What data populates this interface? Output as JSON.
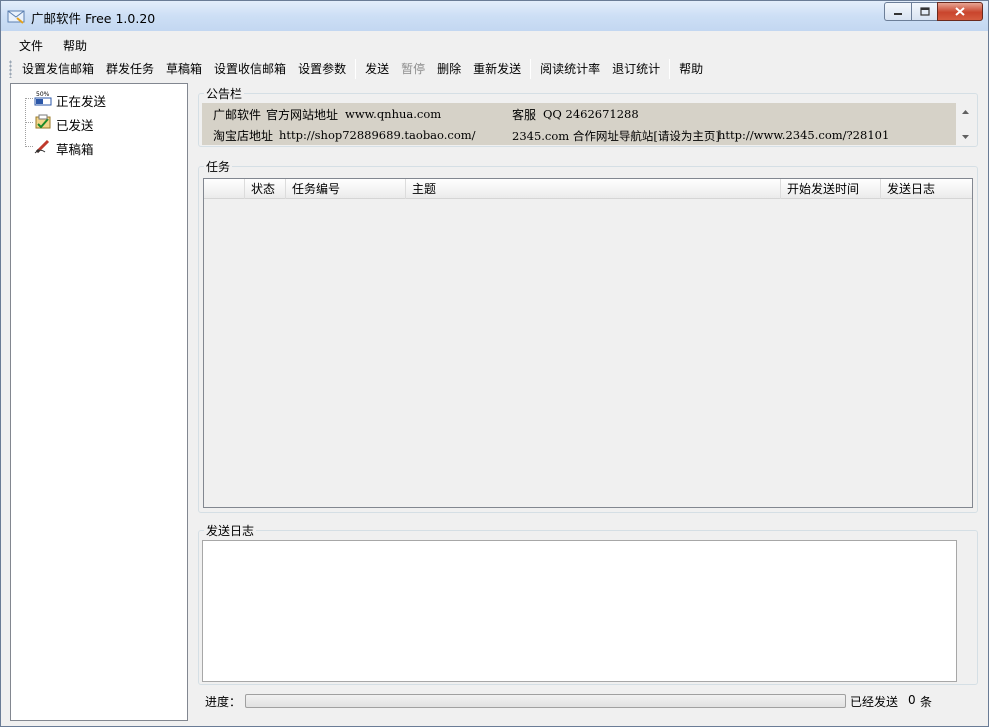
{
  "window": {
    "title": "广邮软件 Free 1.0.20"
  },
  "menu": {
    "items": [
      {
        "label": "文件"
      },
      {
        "label": "帮助"
      }
    ]
  },
  "toolbar": {
    "groups": [
      [
        {
          "label": "设置发信邮箱",
          "enabled": true
        },
        {
          "label": "群发任务",
          "enabled": true
        },
        {
          "label": "草稿箱",
          "enabled": true
        },
        {
          "label": "设置收信邮箱",
          "enabled": true
        },
        {
          "label": "设置参数",
          "enabled": true
        }
      ],
      [
        {
          "label": "发送",
          "enabled": true
        },
        {
          "label": "暂停",
          "enabled": false
        },
        {
          "label": "删除",
          "enabled": true
        },
        {
          "label": "重新发送",
          "enabled": true
        }
      ],
      [
        {
          "label": "阅读统计率",
          "enabled": true
        },
        {
          "label": "退订统计",
          "enabled": true
        }
      ],
      [
        {
          "label": "帮助",
          "enabled": true
        }
      ]
    ]
  },
  "tree": {
    "items": [
      {
        "label": "正在发送",
        "icon": "sending-progress-icon"
      },
      {
        "label": "已发送",
        "icon": "sent-mail-icon"
      },
      {
        "label": "草稿箱",
        "icon": "draft-pen-icon"
      }
    ]
  },
  "notice": {
    "title": "公告栏",
    "row1": {
      "name": "广邮软件",
      "site_label": "官方网站地址",
      "site_url": "www.qnhua.com",
      "service_label": "客服",
      "qq": "QQ 2462671288"
    },
    "row2": {
      "shop_label": "淘宝店地址",
      "shop_url": "http://shop72889689.taobao.com/",
      "partner_text": "2345.com 合作网址导航站[请设为主页]",
      "partner_url": "http://www.2345.com/?28101"
    }
  },
  "tasks": {
    "title": "任务",
    "columns": [
      "",
      "状态",
      "任务编号",
      "主题",
      "开始发送时间",
      "发送日志"
    ],
    "rows": []
  },
  "log": {
    "title": "发送日志",
    "content": ""
  },
  "progress": {
    "label": "进度：",
    "value": 0,
    "sent_label": "已经发送",
    "sent_count": "0",
    "sent_unit": "条"
  },
  "colors": {
    "notice_bg": "#d6d2c8",
    "progress_fill": "#06b025"
  }
}
